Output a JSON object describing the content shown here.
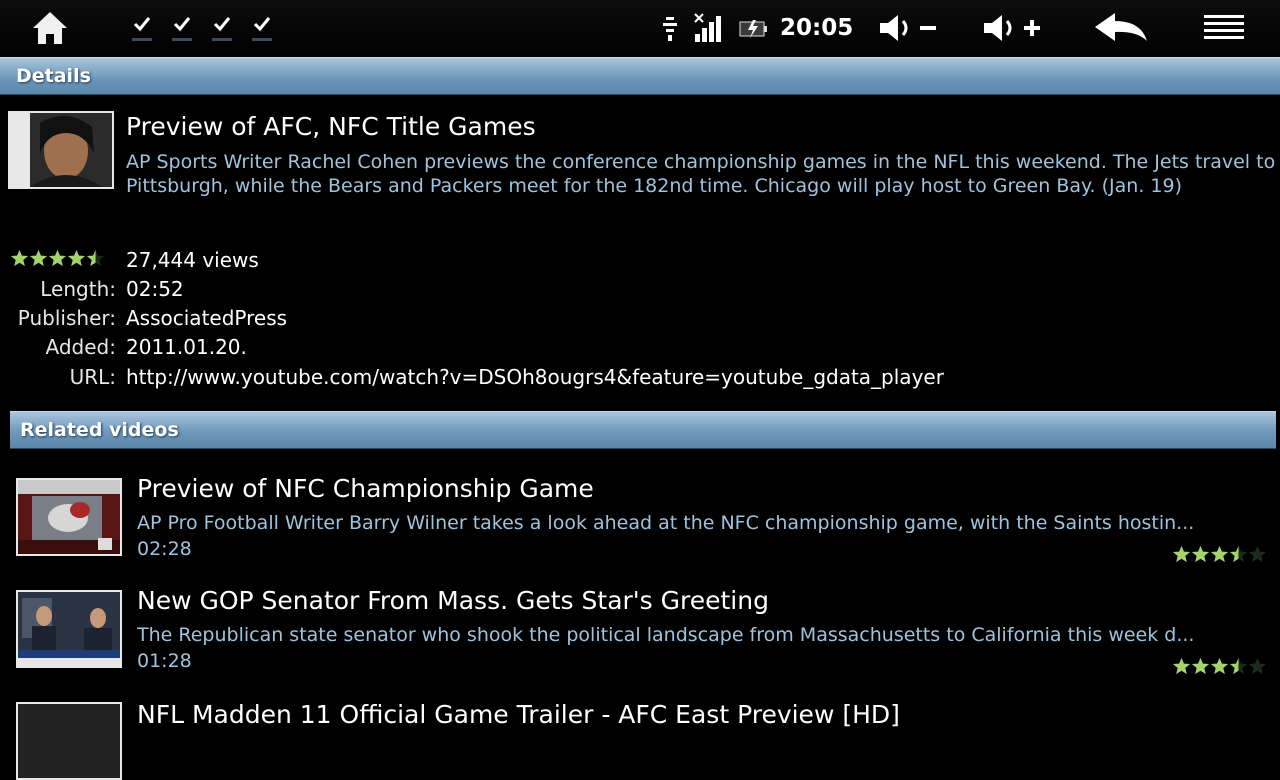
{
  "status_bar": {
    "time": "20:05",
    "icons": [
      "home-icon",
      "notification-check-icon",
      "notification-check-icon",
      "notification-check-icon",
      "notification-check-icon",
      "wifi-icon",
      "signal-icon",
      "battery-icon",
      "volume-down-icon",
      "volume-up-icon",
      "back-icon",
      "menu-icon"
    ]
  },
  "details": {
    "header": "Details",
    "title": "Preview of AFC, NFC Title Games",
    "description": "AP Sports Writer Rachel Cohen previews the conference championship games in the NFL this weekend. The Jets travel to Pittsburgh, while the Bears and Packers meet for the 182nd time. Chicago will play host to Green Bay. (Jan. 19)",
    "rating": 4.5,
    "views": "27,444 views",
    "length_label": "Length:",
    "length": "02:52",
    "publisher_label": "Publisher:",
    "publisher": "AssociatedPress",
    "added_label": "Added:",
    "added": "2011.01.20.",
    "url_label": "URL:",
    "url": "http://www.youtube.com/watch?v=DSOh8ougrs4&feature=youtube_gdata_player"
  },
  "related": {
    "header": "Related videos",
    "items": [
      {
        "title": "Preview of NFC Championship Game",
        "description": "AP Pro Football Writer Barry Wilner takes a look ahead at the NFC championship game, with the Saints hostin...",
        "duration": "02:28",
        "rating": 3.5
      },
      {
        "title": "New GOP Senator From Mass. Gets Star's Greeting",
        "description": "The Republican state senator who shook the political landscape from Massachusetts to California this week d...",
        "duration": "01:28",
        "rating": 3.5
      },
      {
        "title": "NFL Madden 11 Official Game Trailer - AFC East Preview [HD]",
        "description": "",
        "duration": "",
        "rating": null
      }
    ]
  },
  "colors": {
    "header_blue": "#6f98bb",
    "description_blue": "#9fc3dc",
    "star_green": "#a4d46a"
  }
}
